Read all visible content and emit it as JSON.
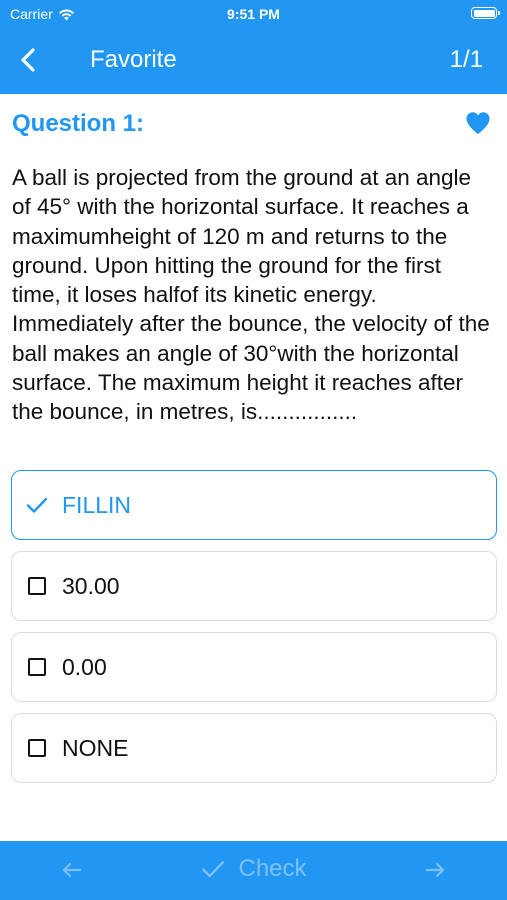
{
  "status_bar": {
    "carrier": "Carrier",
    "time": "9:51 PM"
  },
  "nav": {
    "title": "Favorite",
    "count": "1/1"
  },
  "question": {
    "label": "Question 1:",
    "favorited": true,
    "text": "A ball is projected from the ground at an angle of 45° with the horizontal surface. It reaches a maximumheight of 120 m and returns to the ground. Upon hitting the ground for the first time, it loses halfof its kinetic energy. Immediately after the bounce, the velocity of the ball makes an angle of 30°with the horizontal surface. The maximum height it reaches after the bounce, in metres, is................"
  },
  "options": [
    {
      "label": "FILLIN",
      "selected": true
    },
    {
      "label": "30.00",
      "selected": false
    },
    {
      "label": "0.00",
      "selected": false
    },
    {
      "label": "NONE",
      "selected": false
    }
  ],
  "bottom_bar": {
    "check_label": "Check"
  },
  "colors": {
    "accent": "#2196F3",
    "disabled_on_accent": "#7fc0f3"
  }
}
